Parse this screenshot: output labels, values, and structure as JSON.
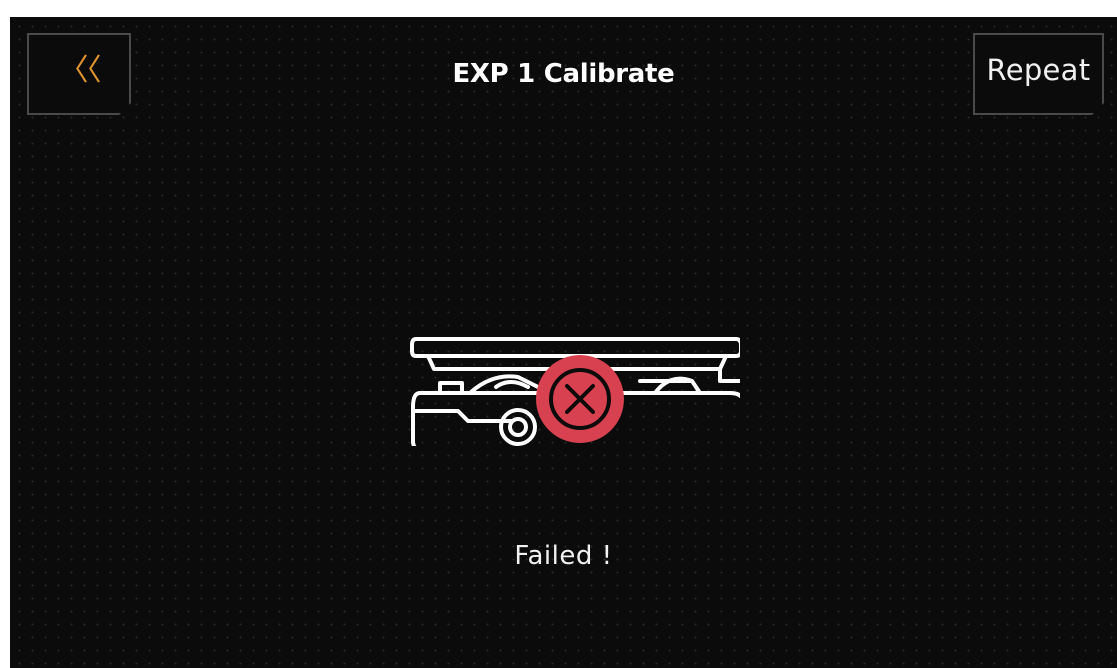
{
  "header": {
    "title": "EXP 1 Calibrate",
    "back_icon": "double-chevron-left-icon",
    "back_glyph": "〈〈",
    "repeat_label": "Repeat"
  },
  "illustration": {
    "device_icon": "expression-pedal-icon",
    "status_icon": "error-x-icon"
  },
  "status": {
    "message": "Failed !"
  },
  "colors": {
    "background": "#0b0b0b",
    "accent": "#e0952e",
    "error": "#d8414f",
    "button_border": "#4a4a4a",
    "text": "#f2f2f2"
  }
}
